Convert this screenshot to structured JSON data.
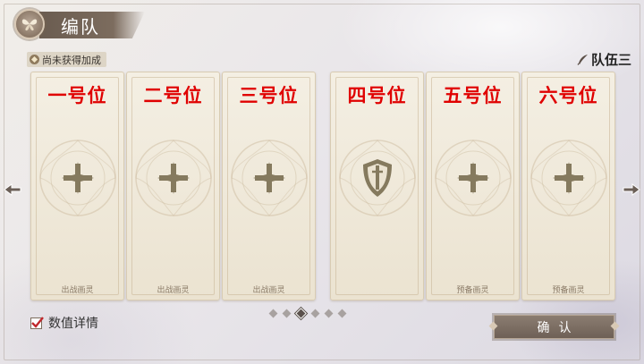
{
  "header": {
    "title": "编队",
    "back_icon": "butterfly-back-icon"
  },
  "bonus_tag": {
    "label": "尚未获得加成",
    "icon": "bonus-diamond-icon"
  },
  "team": {
    "name": "队伍三",
    "edit_icon": "quill-icon"
  },
  "slots": [
    {
      "title": "一号位",
      "footer": "出战画灵",
      "icon": "plus-icon"
    },
    {
      "title": "二号位",
      "footer": "出战画灵",
      "icon": "plus-icon"
    },
    {
      "title": "三号位",
      "footer": "出战画灵",
      "icon": "plus-icon"
    },
    {
      "title": "四号位",
      "footer": "",
      "icon": "shield-icon"
    },
    {
      "title": "五号位",
      "footer": "预备画灵",
      "icon": "plus-icon"
    },
    {
      "title": "六号位",
      "footer": "预备画灵",
      "icon": "plus-icon"
    }
  ],
  "pagination": {
    "total": 6,
    "current": 3
  },
  "stats_toggle": {
    "label": "数值详情",
    "checked": true
  },
  "confirm": {
    "label": "确认"
  },
  "colors": {
    "slot_title": "#e00000",
    "accent_dark": "#6e6056",
    "card_bg": "#f4efe3"
  }
}
